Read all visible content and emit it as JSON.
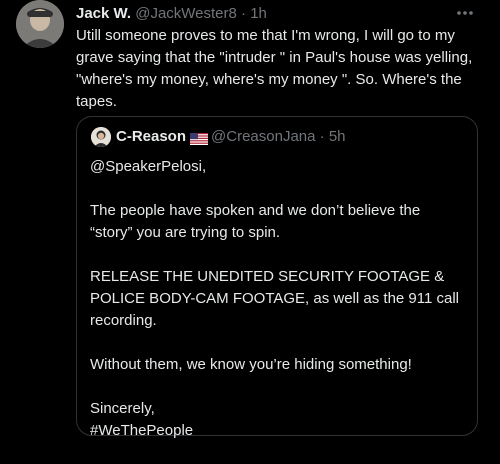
{
  "tweet": {
    "author_name": "Jack W.",
    "author_handle": "@JackWester8",
    "separator": "·",
    "time": "1h",
    "more_icon": "more-horizontal-icon",
    "text": "Utill someone proves to me that I'm wrong, I will go to my grave saying that the \"intruder \" in Paul's house was yelling, \"where's my money, where's my money \". So. Where's the tapes."
  },
  "quoted_tweet": {
    "author_name": "C-Reason",
    "flag_icon": "us-flag-icon",
    "author_handle": "@CreasonJana",
    "separator": "·",
    "time": "5h",
    "paragraphs": [
      "@SpeakerPelosi,",
      "The people have spoken and we don’t believe the “story” you are trying to spin.",
      "RELEASE THE UNEDITED SECURITY FOOTAGE & POLICE BODY-CAM FOOTAGE, as well as the 911 call recording.",
      "Without them, we know you’re hiding something!",
      "Sincerely,",
      "#WeThePeople"
    ]
  },
  "colors": {
    "background": "#000000",
    "text_primary": "#e7e9ea",
    "text_secondary": "#71767b",
    "border": "#2f3336"
  }
}
